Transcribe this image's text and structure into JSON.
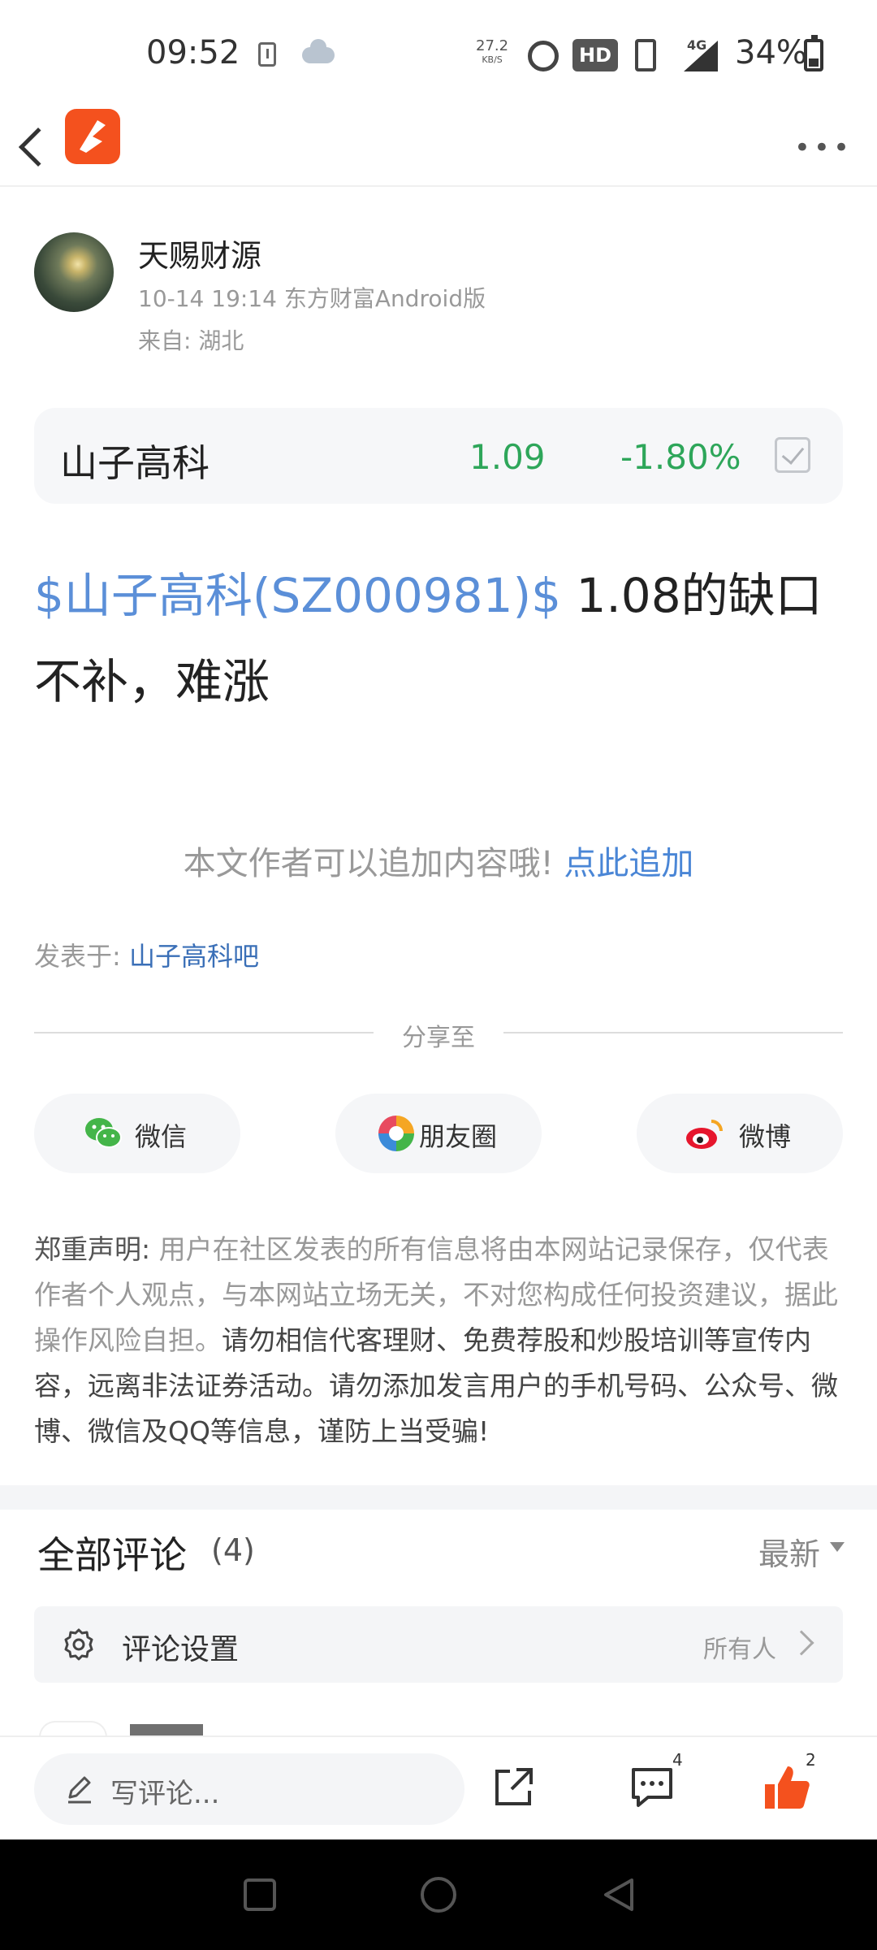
{
  "status_bar": {
    "time": "09:52",
    "net_speed": "27.2",
    "net_speed_unit": "KB/S",
    "hd": "HD",
    "network": "4G",
    "battery": "34%"
  },
  "author": {
    "name": "天赐财源",
    "meta": "10-14 19:14 东方财富Android版",
    "from": "来自: 湖北"
  },
  "stock": {
    "name": "山子高科",
    "price": "1.09",
    "change": "-1.80%"
  },
  "post": {
    "tag": "$山子高科(SZ000981)$",
    "text": " 1.08的缺口不补，难涨"
  },
  "append": {
    "prompt": "本文作者可以追加内容哦! ",
    "link": "点此追加"
  },
  "posted_in": {
    "label": "发表于: ",
    "bar": "山子高科吧"
  },
  "share": {
    "label": "分享至",
    "wechat": "微信",
    "moments": "朋友圈",
    "weibo": "微博"
  },
  "disclaimer": {
    "title": "郑重声明: ",
    "body": "用户在社区发表的所有信息将由本网站记录保存，仅代表作者个人观点，与本网站立场无关，不对您构成任何投资建议，据此操作风险自担。",
    "warning": "请勿相信代客理财、免费荐股和炒股培训等宣传内容，远离非法证券活动。请勿添加发言用户的手机号码、公众号、微博、微信及QQ等信息，谨防上当受骗!"
  },
  "comments": {
    "title": "全部评论",
    "count": "(4)",
    "sort": "最新",
    "settings_label": "评论设置",
    "settings_value": "所有人"
  },
  "bottom_bar": {
    "placeholder": "写评论...",
    "comment_count": "4",
    "like_count": "2"
  },
  "colors": {
    "accent_orange": "#f4511e",
    "link_blue": "#4a86d6",
    "down_green": "#2ea65a"
  }
}
